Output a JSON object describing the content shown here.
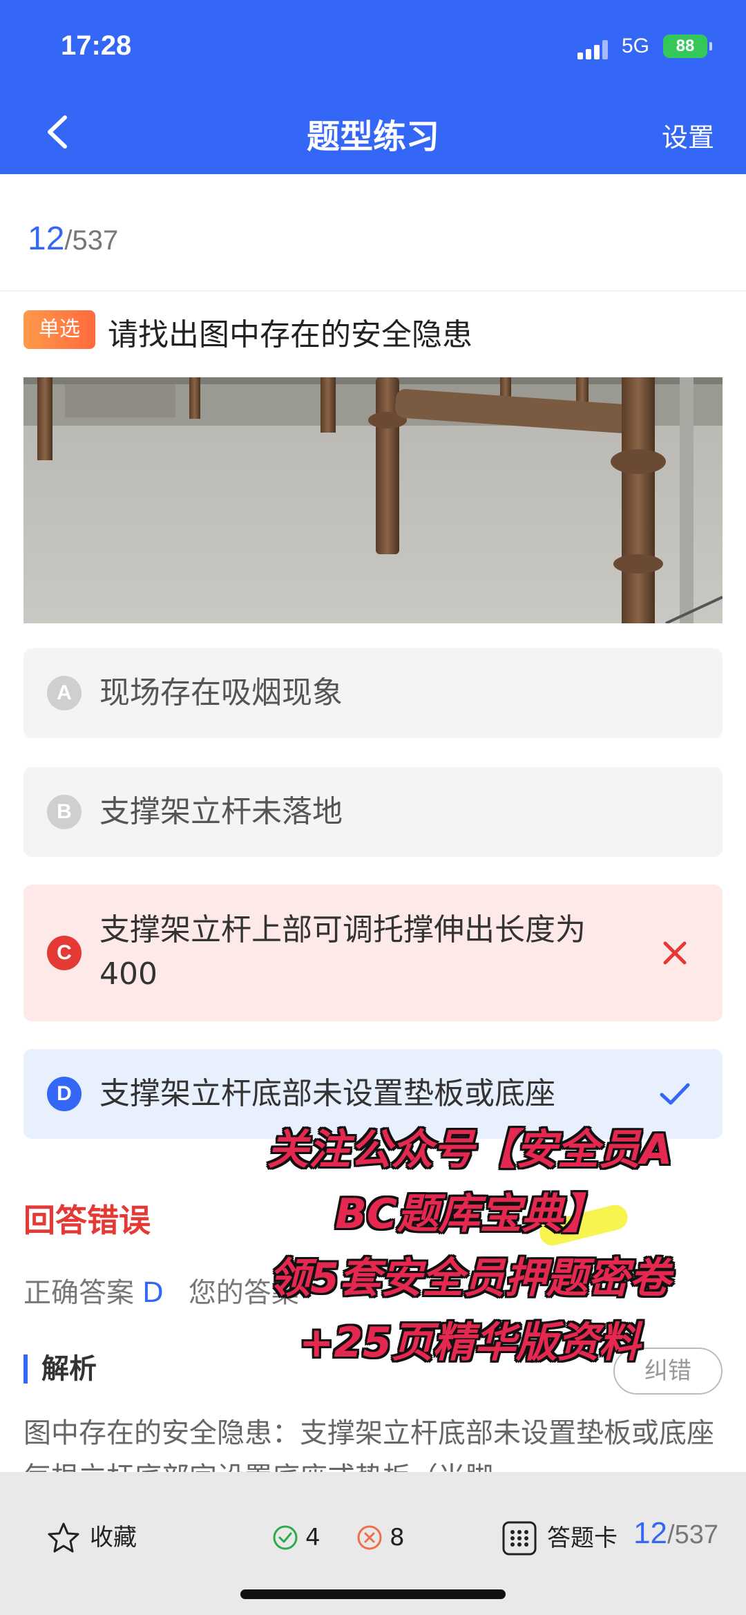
{
  "status": {
    "time": "17:28",
    "network": "5G",
    "battery": "88"
  },
  "nav": {
    "title": "题型练习",
    "settings": "设置"
  },
  "progress": {
    "current": "12",
    "total": "/537"
  },
  "question": {
    "type": "单选",
    "text": "请找出图中存在的安全隐患"
  },
  "options": [
    {
      "letter": "A",
      "text": "现场存在吸烟现象"
    },
    {
      "letter": "B",
      "text": "支撑架立杆未落地"
    },
    {
      "letter": "C",
      "text": "支撑架立杆上部可调托撑伸出长度为",
      "text2": "400"
    },
    {
      "letter": "D",
      "text": "支撑架立杆底部未设置垫板或底座"
    }
  ],
  "result": {
    "label": "回答错误",
    "correct_label": "正确答案",
    "correct_value": "D",
    "yours_label": "您的答案"
  },
  "analysis": {
    "title": "解析",
    "report": "纠错",
    "text": "图中存在的安全隐患：支撑架立杆底部未设置垫板或底座每根立杆底部宜设置底座或垫板（当脚"
  },
  "promo": {
    "line1": "关注公众号【安全员A",
    "line2": "BC题库宝典】",
    "line3": "领5套安全员押题密卷",
    "line4": "+25页精华版资料"
  },
  "bottom": {
    "favorite": "收藏",
    "correct_count": "4",
    "wrong_count": "8",
    "answer_card": "答题卡",
    "current": "12",
    "total": "/537"
  },
  "colors": {
    "primary": "#3567f6",
    "wrong": "#e53935",
    "correct": "#3567f6",
    "badge": "#ff7a3d"
  }
}
